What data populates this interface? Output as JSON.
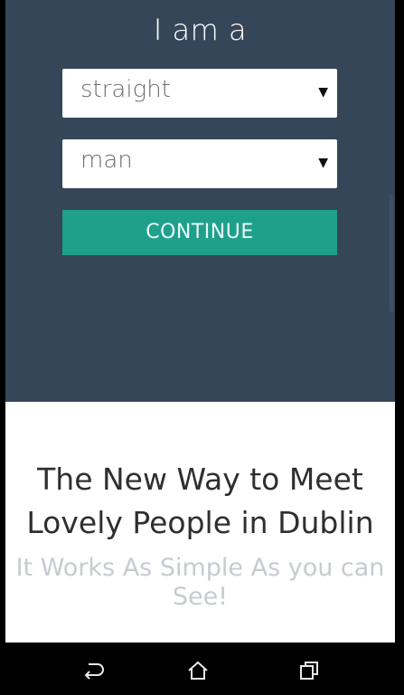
{
  "form": {
    "heading": "I am a",
    "orientation_select": {
      "value": "straight"
    },
    "gender_select": {
      "value": "man"
    },
    "continue_label": "CONTINUE"
  },
  "promo": {
    "title": "The New Way to Meet Lovely People in Dublin",
    "subtitle": "It Works As Simple As you can See!"
  },
  "colors": {
    "top_background": "#364659",
    "accent_button": "#1fa08c",
    "bottom_background": "#ffffff"
  },
  "navigation_bar": {
    "icons": [
      "back-icon",
      "home-icon",
      "recent-apps-icon"
    ]
  }
}
